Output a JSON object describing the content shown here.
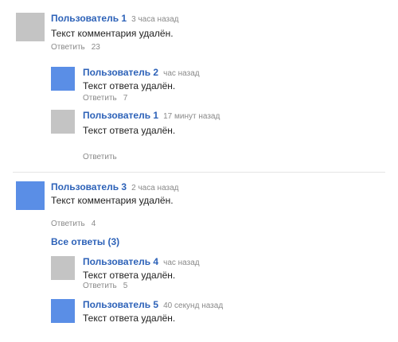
{
  "comments": [
    {
      "author": "Пользователь 1",
      "time": "3 часа назад",
      "text": "Текст комментария удалён.",
      "likes": "23"
    },
    {
      "author": "Пользователь 2",
      "time": "час назад",
      "text": "Текст ответа удалён.",
      "likes": "7"
    },
    {
      "author": "Пользователь 1",
      "time": "17 минут назад",
      "text": "Текст ответа удалён.",
      "likes": ""
    }
  ],
  "thread": {
    "author": "Пользователь 3",
    "time": "2 часа назад",
    "text": "Текст комментария удалён.",
    "likes": "4",
    "more_label": "Все ответы (3)",
    "replies": [
      {
        "author": "Пользователь 4",
        "time": "час назад",
        "text": "Текст ответа удалён.",
        "likes": "5"
      },
      {
        "author": "Пользователь 5",
        "time": "40 секунд назад",
        "text": "Текст ответа удалён.",
        "likes": ""
      }
    ]
  },
  "labels": {
    "reply": "Ответить"
  }
}
